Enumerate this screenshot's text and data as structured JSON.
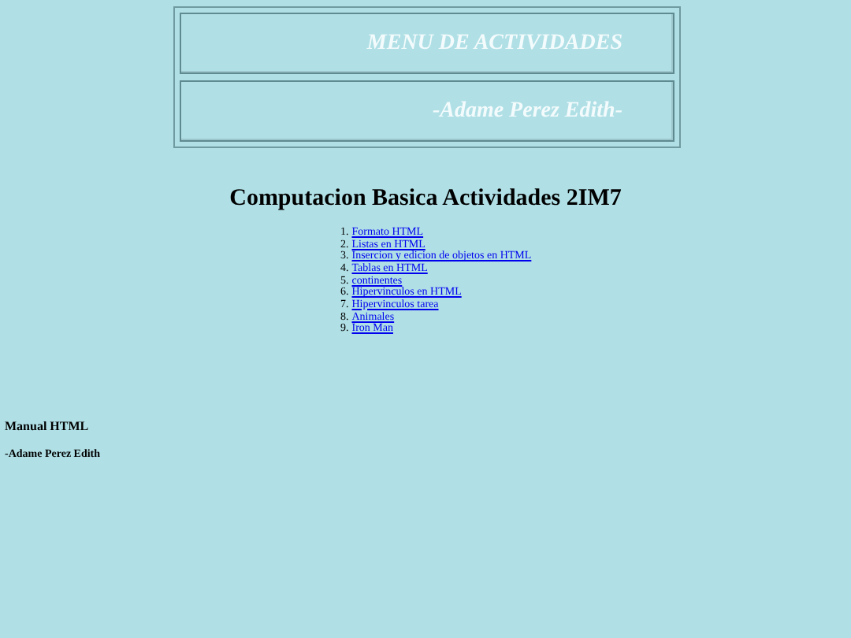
{
  "banner": {
    "title": "MENU DE ACTIVIDADES",
    "author": "-Adame Perez Edith-"
  },
  "heading": "Computacion Basica Actividades 2IM7",
  "activities": [
    {
      "number": "1.",
      "label": "Formato HTML"
    },
    {
      "number": "2.",
      "label": "Listas en HTML"
    },
    {
      "number": "3.",
      "label": "Insercion y edicion de objetos en HTML"
    },
    {
      "number": "4.",
      "label": "Tablas en HTML"
    },
    {
      "number": "5.",
      "label": "continentes"
    },
    {
      "number": "6.",
      "label": "Hipervinculos en HTML"
    },
    {
      "number": "7.",
      "label": "Hipervinculos tarea"
    },
    {
      "number": "8.",
      "label": "Animales"
    },
    {
      "number": "9.",
      "label": "Iron Man"
    }
  ],
  "footer": {
    "title": "Manual HTML",
    "author": "-Adame Perez Edith"
  }
}
